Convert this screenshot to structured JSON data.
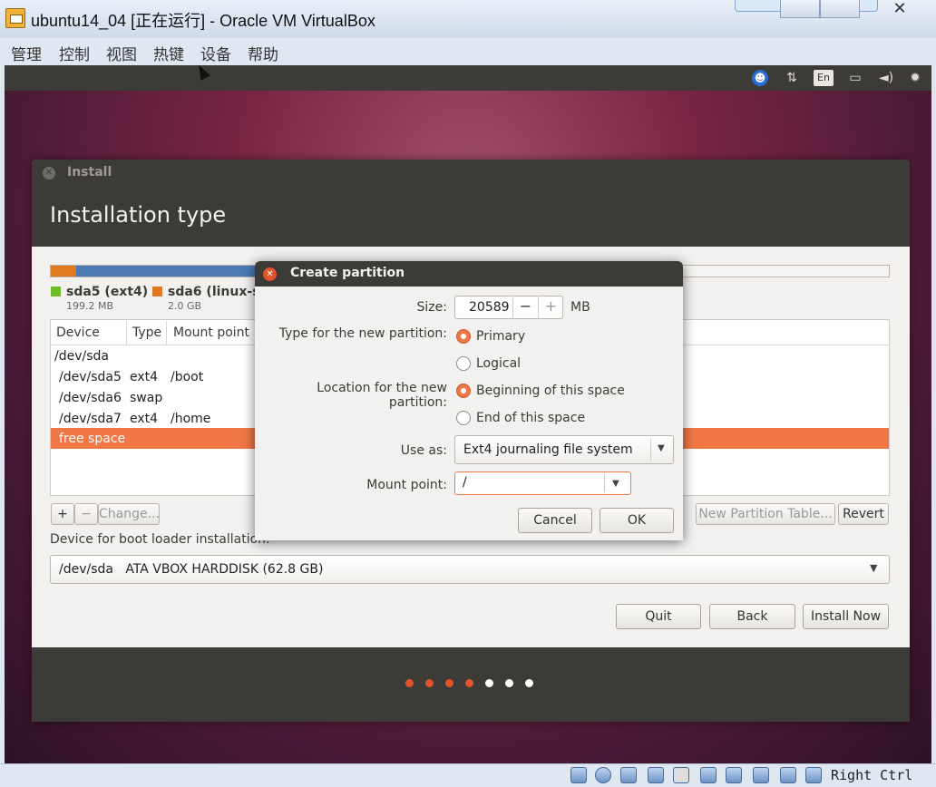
{
  "window": {
    "title": "ubuntu14_04 [正在运行] - Oracle VM VirtualBox",
    "close_glyph": "✕"
  },
  "menu": {
    "items": [
      "管理",
      "控制",
      "视图",
      "热键",
      "设备",
      "帮助"
    ]
  },
  "guest_topbar": {
    "accessibility_glyph": "☻",
    "network_glyph": "⇅",
    "language": "En",
    "battery_glyph": "▭",
    "volume_glyph": "◄)",
    "settings_glyph": "✹"
  },
  "installer": {
    "window_title": "Install",
    "heading": "Installation type",
    "partitions_bar": [
      {
        "name": "sda5",
        "color": "#e07a20",
        "share": 0.03
      },
      {
        "name": "sda6",
        "color": "#4b7ab5",
        "share": 0.72
      },
      {
        "name": "free",
        "color": "#f5f4f2",
        "share": 0.25
      }
    ],
    "legend": [
      {
        "name": "sda5 (ext4)",
        "size": "199.2 MB",
        "color": "#6dbd2a"
      },
      {
        "name": "sda6 (linux-sw",
        "size": "2.0 GB",
        "color": "#e07a20"
      }
    ],
    "table": {
      "headers": [
        "Device",
        "Type",
        "Mount point"
      ],
      "rows": [
        {
          "device": "/dev/sda",
          "type": "",
          "mount": ""
        },
        {
          "device": "/dev/sda5",
          "type": "ext4",
          "mount": "/boot"
        },
        {
          "device": "/dev/sda6",
          "type": "swap",
          "mount": ""
        },
        {
          "device": "/dev/sda7",
          "type": "ext4",
          "mount": "/home"
        },
        {
          "device": "free space",
          "type": "",
          "mount": "",
          "selected": true
        }
      ]
    },
    "toolbar": {
      "add": "+",
      "remove": "−",
      "change": "Change...",
      "new_table": "New Partition Table...",
      "revert": "Revert"
    },
    "boot_loader": {
      "label": "Device for boot loader installation:",
      "value": "/dev/sda   ATA VBOX HARDDISK (62.8 GB)"
    },
    "buttons": {
      "quit": "Quit",
      "back": "Back",
      "install_now": "Install Now"
    },
    "progress_dots": {
      "total": 7,
      "filled": 4,
      "filled_color": "#e0542b",
      "empty_color": "#ffffff"
    }
  },
  "dialog": {
    "title": "Create partition",
    "size_label": "Size:",
    "size_value": "20589",
    "size_unit": "MB",
    "type_label": "Type for the new partition:",
    "type_options": [
      {
        "label": "Primary",
        "selected": true
      },
      {
        "label": "Logical",
        "selected": false
      }
    ],
    "location_label": "Location for the new partition:",
    "location_options": [
      {
        "label": "Beginning of this space",
        "selected": true
      },
      {
        "label": "End of this space",
        "selected": false
      }
    ],
    "use_as_label": "Use as:",
    "use_as_value": "Ext4 journaling file system",
    "mount_label": "Mount point:",
    "mount_value": "/",
    "cancel": "Cancel",
    "ok": "OK"
  },
  "statusbar": {
    "host_key": "Right Ctrl"
  }
}
